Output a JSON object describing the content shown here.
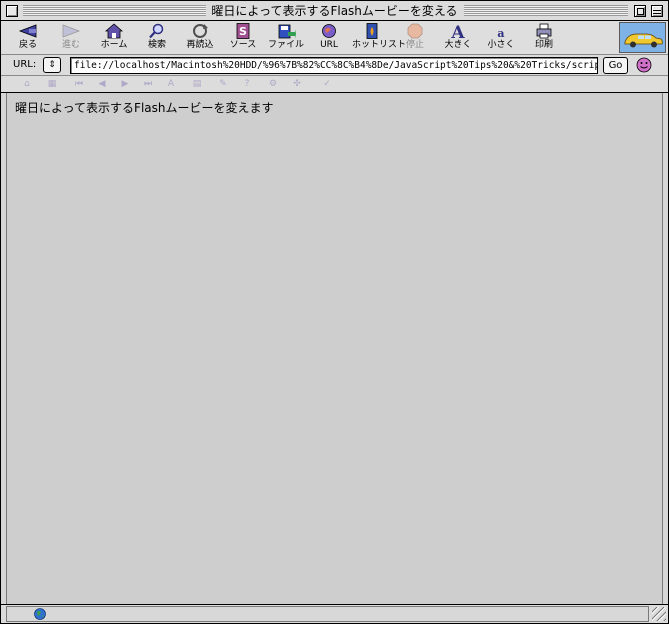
{
  "window": {
    "title": "曜日によって表示するFlashムービーを変える"
  },
  "toolbar": {
    "buttons": [
      {
        "label": "戻る",
        "icon": "back-arrow-icon",
        "enabled": true
      },
      {
        "label": "進む",
        "icon": "forward-arrow-icon",
        "enabled": false
      },
      {
        "label": "ホーム",
        "icon": "home-icon",
        "enabled": true
      },
      {
        "label": "検索",
        "icon": "search-magnifier-icon",
        "enabled": true
      },
      {
        "label": "再読込",
        "icon": "reload-icon",
        "enabled": true
      },
      {
        "label": "ソース",
        "icon": "source-icon",
        "enabled": true
      },
      {
        "label": "ファイル",
        "icon": "file-icon",
        "enabled": true
      },
      {
        "label": "URL",
        "icon": "url-globe-icon",
        "enabled": true
      },
      {
        "label": "ホットリスト",
        "icon": "hotlist-icon",
        "enabled": true
      },
      {
        "label": "停止",
        "icon": "stop-icon",
        "enabled": false
      },
      {
        "label": "大きく",
        "icon": "larger-text-icon",
        "enabled": true
      },
      {
        "label": "小さく",
        "icon": "smaller-text-icon",
        "enabled": true
      },
      {
        "label": "印刷",
        "icon": "print-icon",
        "enabled": true
      }
    ],
    "logo_icon": "browser-logo-car-icon"
  },
  "location": {
    "label": "URL:",
    "popup_symbol": "⇕",
    "url": "file://localhost/Macintosh%20HDD/%96%7B%82%CC%8C%B4%8De/JavaScript%20Tips%20&%20Tricks/scrip",
    "go_label": "Go",
    "status_icon": "smiley-face-icon"
  },
  "content": {
    "text": "曜日によって表示するFlashムービーを変えます"
  },
  "statusbar": {
    "icon": "globe-icon"
  },
  "colors": {
    "content_bg": "#cecece",
    "chrome_bg": "#dcdcdc",
    "logo_bg": "#7fb2e6"
  }
}
